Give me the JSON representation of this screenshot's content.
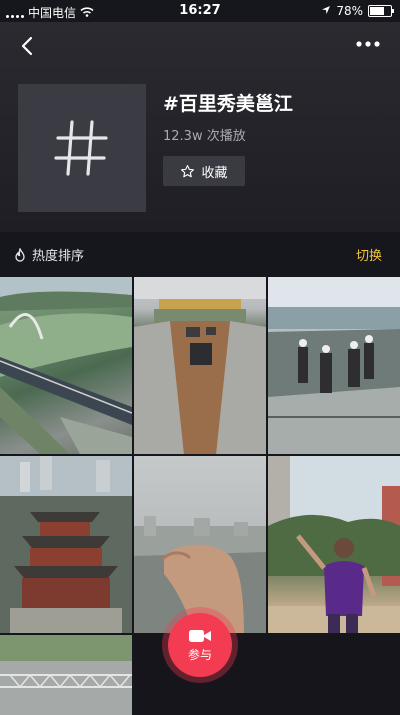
{
  "status": {
    "carrier": "中国电信",
    "time": "16:27",
    "battery": "78%",
    "battery_level": 0.78
  },
  "header": {
    "title": "#百里秀美邕江",
    "plays": "12.3w 次播放",
    "favorite_label": "收藏"
  },
  "sort": {
    "label": "热度排序",
    "switch_label": "切换"
  },
  "join": {
    "label": "参与"
  },
  "colors": {
    "accent": "#f33c52",
    "switch": "#f3c43a"
  },
  "grid": {
    "tiles": [
      {
        "name": "aerial-bridge-river"
      },
      {
        "name": "ship-lock-boats"
      },
      {
        "name": "workers-on-dam"
      },
      {
        "name": "pagoda-tower"
      },
      {
        "name": "hand-foggy-city"
      },
      {
        "name": "woman-dancing"
      },
      {
        "name": "bridge-steel"
      },
      {
        "name": "blank-1"
      },
      {
        "name": "blank-2"
      }
    ]
  }
}
